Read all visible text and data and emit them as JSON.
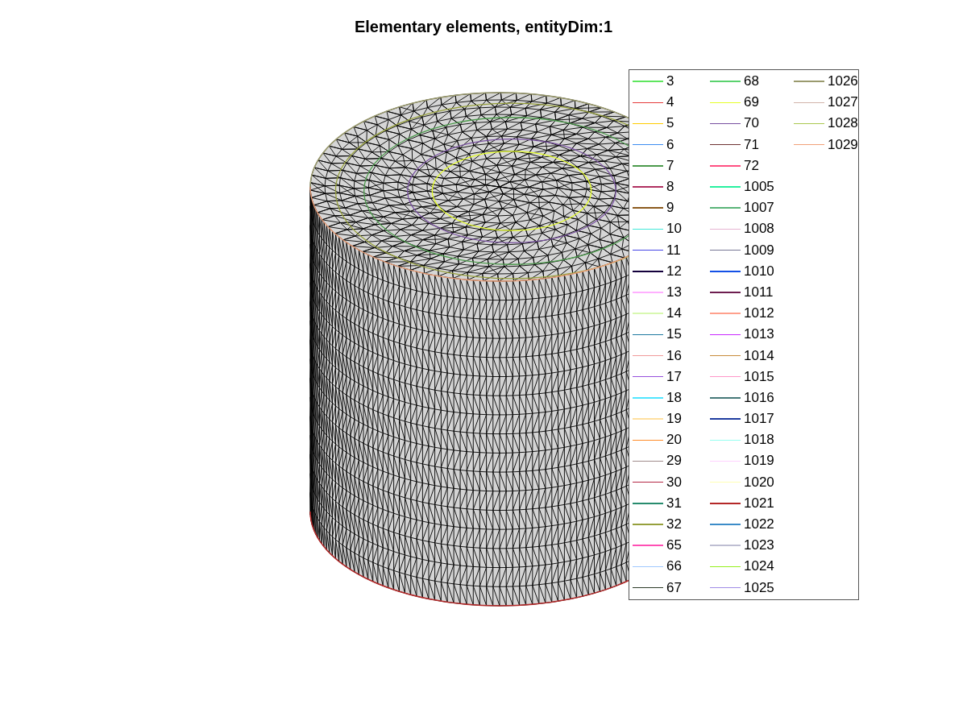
{
  "figure": {
    "title": "Elementary elements, entityDim:1"
  },
  "legend": {
    "items": [
      {
        "label": "3",
        "color": "#5fe65f"
      },
      {
        "label": "4",
        "color": "#e63c3c"
      },
      {
        "label": "5",
        "color": "#ffcc00"
      },
      {
        "label": "6",
        "color": "#3c8cf0"
      },
      {
        "label": "7",
        "color": "#4c9a4c"
      },
      {
        "label": "8",
        "color": "#b03060"
      },
      {
        "label": "9",
        "color": "#8b5a1e"
      },
      {
        "label": "10",
        "color": "#40e8d8"
      },
      {
        "label": "11",
        "color": "#4646e6"
      },
      {
        "label": "12",
        "color": "#14003c"
      },
      {
        "label": "13",
        "color": "#ffb0ff"
      },
      {
        "label": "14",
        "color": "#d8f8b0"
      },
      {
        "label": "15",
        "color": "#1e78a0"
      },
      {
        "label": "16",
        "color": "#f09a9a"
      },
      {
        "label": "17",
        "color": "#9650dc"
      },
      {
        "label": "18",
        "color": "#50e6ff"
      },
      {
        "label": "19",
        "color": "#ffe0a0"
      },
      {
        "label": "20",
        "color": "#ff8c28"
      },
      {
        "label": "29",
        "color": "#a08c8c"
      },
      {
        "label": "30",
        "color": "#b42846"
      },
      {
        "label": "31",
        "color": "#288c6e"
      },
      {
        "label": "32",
        "color": "#96a03c"
      },
      {
        "label": "65",
        "color": "#ff50b4"
      },
      {
        "label": "66",
        "color": "#a0c8ff"
      },
      {
        "label": "67",
        "color": "#2d3c28"
      },
      {
        "label": "68",
        "color": "#5ad26e"
      },
      {
        "label": "69",
        "color": "#e6ff28"
      },
      {
        "label": "70",
        "color": "#7850a0"
      },
      {
        "label": "71",
        "color": "#6e3232"
      },
      {
        "label": "72",
        "color": "#ff5082"
      },
      {
        "label": "1005",
        "color": "#28f0a0"
      },
      {
        "label": "1007",
        "color": "#5ab478"
      },
      {
        "label": "1008",
        "color": "#e6b4d2"
      },
      {
        "label": "1009",
        "color": "#787896"
      },
      {
        "label": "1010",
        "color": "#1450e6"
      },
      {
        "label": "1011",
        "color": "#6e1e50"
      },
      {
        "label": "1012",
        "color": "#ffa08c"
      },
      {
        "label": "1013",
        "color": "#c828ff"
      },
      {
        "label": "1014",
        "color": "#c88c3c"
      },
      {
        "label": "1015",
        "color": "#ff96c8"
      },
      {
        "label": "1016",
        "color": "#467878"
      },
      {
        "label": "1017",
        "color": "#1e3ca0"
      },
      {
        "label": "1018",
        "color": "#96fff0"
      },
      {
        "label": "1019",
        "color": "#ffd2ff"
      },
      {
        "label": "1020",
        "color": "#ffffb4"
      },
      {
        "label": "1021",
        "color": "#b42828"
      },
      {
        "label": "1022",
        "color": "#3c8cc8"
      },
      {
        "label": "1023",
        "color": "#bebed2"
      },
      {
        "label": "1024",
        "color": "#96f01e"
      },
      {
        "label": "1025",
        "color": "#a08ce6"
      },
      {
        "label": "1026",
        "color": "#9a9a6e"
      },
      {
        "label": "1027",
        "color": "#d2b4aa"
      },
      {
        "label": "1028",
        "color": "#aac850"
      },
      {
        "label": "1029",
        "color": "#f0a078"
      }
    ]
  }
}
